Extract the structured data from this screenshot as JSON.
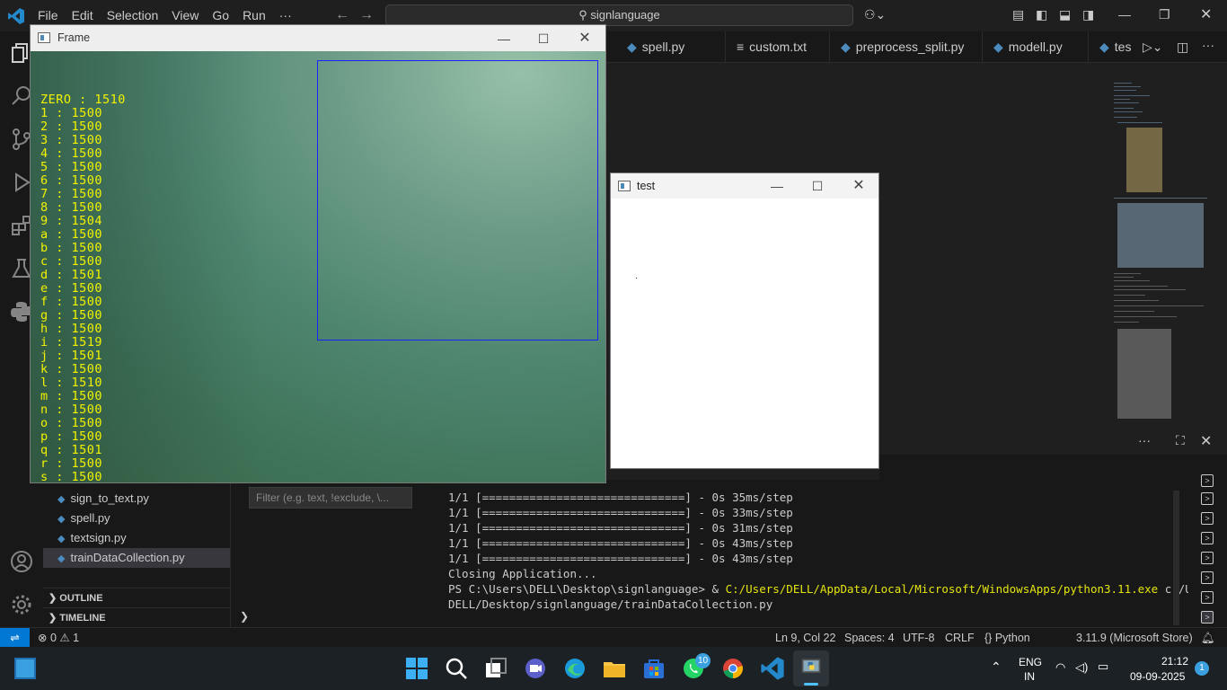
{
  "vscode": {
    "menu": [
      "File",
      "Edit",
      "Selection",
      "View",
      "Go",
      "Run",
      "···"
    ],
    "search": "signlanguage",
    "tabs": [
      {
        "label": "spell.py",
        "icon": "python-file-icon"
      },
      {
        "label": "custom.txt",
        "icon": "text-file-icon"
      },
      {
        "label": "preprocess_split.py",
        "icon": "python-file-icon"
      },
      {
        "label": "modell.py",
        "icon": "python-file-icon"
      },
      {
        "label": "tes",
        "icon": "python-file-icon"
      }
    ],
    "explorer": {
      "items": [
        {
          "label": "sign_to_text.py"
        },
        {
          "label": "spell.py"
        },
        {
          "label": "textsign.py"
        },
        {
          "label": "trainDataCollection.py"
        }
      ],
      "outline": "OUTLINE",
      "timeline": "TIMELINE"
    },
    "filter_placeholder": "Filter (e.g. text, !exclude, \\...",
    "terminal": {
      "lines": [
        "1/1 [==============================] - 0s 35ms/step",
        "1/1 [==============================] - 0s 33ms/step",
        "1/1 [==============================] - 0s 31ms/step",
        "1/1 [==============================] - 0s 43ms/step",
        "1/1 [==============================] - 0s 43ms/step",
        "Closing Application..."
      ],
      "ps_prefix": "PS C:\\Users\\DELL\\Desktop\\signlanguage> & ",
      "ps_exe": "C:/Users/DELL/AppData/Local/Microsoft/WindowsApps/python3.11.exe",
      "ps_arg1": " c:/Users/",
      "ps_arg2": "DELL/Desktop/signlanguage/trainDataCollection.py"
    },
    "status": {
      "errors": "0",
      "warnings": "1",
      "position": "Ln 9, Col 22",
      "spaces": "Spaces: 4",
      "encoding": "UTF-8",
      "eol": "CRLF",
      "language": "Python",
      "interpreter": "3.11.9 (Microsoft Store)"
    }
  },
  "frame_window": {
    "title": "Frame",
    "counts": [
      "ZERO : 1510",
      "1 : 1500",
      "2 : 1500",
      "3 : 1500",
      "4 : 1500",
      "5 : 1500",
      "6 : 1500",
      "7 : 1500",
      "8 : 1500",
      "9 : 1504",
      "a : 1500",
      "b : 1500",
      "c : 1500",
      "d : 1501",
      "e : 1500",
      "f : 1500",
      "g : 1500",
      "h : 1500",
      "i : 1519",
      "j : 1501",
      "k : 1500",
      "l : 1510",
      "m : 1500",
      "n : 1500",
      "o : 1500",
      "p : 1500",
      "q : 1501",
      "r : 1500",
      "s : 1500"
    ]
  },
  "test_window": {
    "title": "test"
  },
  "taskbar": {
    "lang1": "ENG",
    "lang2": "IN",
    "time": "21:12",
    "date": "09-09-2025",
    "whatsapp_badge": "10",
    "notif_count": "1"
  }
}
